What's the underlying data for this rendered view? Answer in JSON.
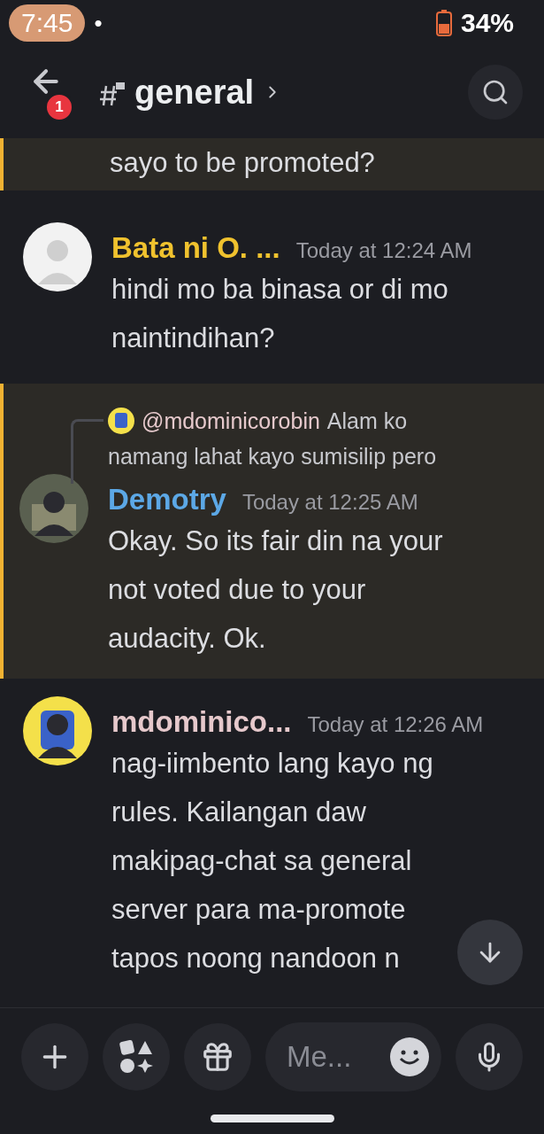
{
  "status_bar": {
    "time": "7:45",
    "dot": "•",
    "battery": "34%"
  },
  "header": {
    "channel": "general",
    "badge": "1"
  },
  "messages": [
    {
      "kind": "continuation",
      "mentioned": true,
      "lines": [
        "sayo to be promoted?"
      ]
    },
    {
      "kind": "message",
      "mentioned": false,
      "author": "Bata ni O. ...",
      "color": "#f0c22e",
      "time": "Today at 12:24 AM",
      "lines": [
        "hindi mo ba binasa or di mo",
        "naintindihan?"
      ]
    },
    {
      "kind": "message",
      "mentioned": true,
      "reply": {
        "author": "@mdominicorobin",
        "text": "Alam ko",
        "text2": "namang lahat kayo sumisilip pero"
      },
      "author": "Demotry",
      "color": "#5ca8e6",
      "time": "Today at 12:25 AM",
      "lines": [
        "Okay. So its fair din na your",
        "not voted due to your",
        "audacity. Ok."
      ]
    },
    {
      "kind": "message",
      "mentioned": false,
      "author": "mdominico...",
      "color": "#e6c9cc",
      "time": "Today at 12:26 AM",
      "lines": [
        "nag-iimbento lang kayo ng",
        "rules. Kailangan daw",
        "makipag-chat sa general",
        "server para ma-promote",
        "tapos noong nandoon n"
      ]
    }
  ],
  "composer": {
    "placeholder": "Me..."
  }
}
